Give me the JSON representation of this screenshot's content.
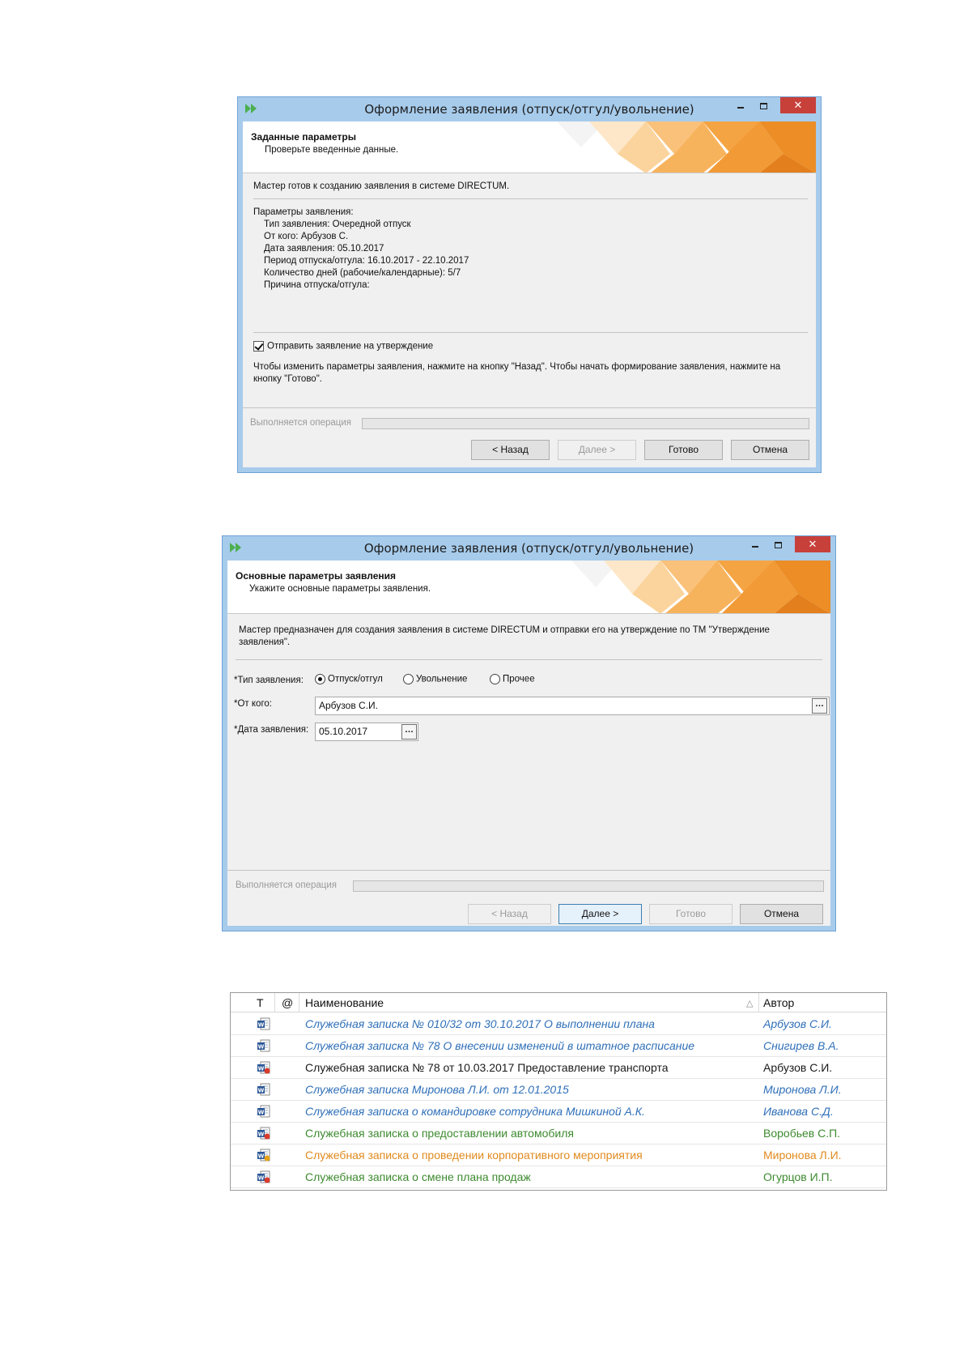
{
  "dialog1": {
    "title": "Оформление заявления (отпуск/отгул/увольнение)",
    "header_title": "Заданные параметры",
    "header_sub": "Проверьте введенные данные.",
    "intro": "Мастер готов к созданию заявления в системе DIRECTUM.",
    "params_title": "Параметры заявления:",
    "params": [
      "Тип заявления:  Очередной отпуск",
      "От кого:  Арбузов С.",
      "Дата заявления:  05.10.2017",
      "Период отпуска/отгула:  16.10.2017 - 22.10.2017",
      "Количество дней (рабочие/календарные):  5/7",
      "Причина отпуска/отгула:"
    ],
    "checkbox_label": "Отправить заявление на утверждение",
    "hint_line1": "Чтобы изменить параметры заявления, нажмите на кнопку \"Назад\". Чтобы начать формирование заявления, нажмите на",
    "hint_line2": "кнопку \"Готово\".",
    "op_label": "Выполняется операция",
    "buttons": {
      "back": "< Назад",
      "next": "Далее >",
      "finish": "Готово",
      "cancel": "Отмена"
    }
  },
  "dialog2": {
    "title": "Оформление заявления (отпуск/отгул/увольнение)",
    "header_title": "Основные параметры заявления",
    "header_sub": "Укажите основные параметры заявления.",
    "intro_line1": "Мастер предназначен для создания заявления в системе DIRECTUM и отправки его на утверждение по ТМ \"Утверждение",
    "intro_line2": "заявления\".",
    "type_label": "*Тип заявления:",
    "radios": [
      "Отпуск/отгул",
      "Увольнение",
      "Прочее"
    ],
    "from_label": "*От кого:",
    "from_value": "Арбузов С.И.",
    "date_label": "*Дата заявления:",
    "date_value": "05.10.2017",
    "op_label": "Выполняется операция",
    "buttons": {
      "back": "< Назад",
      "next": "Далее >",
      "finish": "Готово",
      "cancel": "Отмена"
    }
  },
  "list": {
    "headers": {
      "type": "Т",
      "at": "@",
      "name": "Наименование",
      "author": "Автор"
    },
    "rows": [
      {
        "name": "Служебная записка № 010/32 от 30.10.2017 О выполнении плана",
        "author": "Арбузов С.И.",
        "color": "#2e6fb8",
        "italic": true
      },
      {
        "name": "Служебная записка № 78 О внесении изменений в штатное расписание",
        "author": "Снигирев В.А.",
        "color": "#2e6fb8",
        "italic": true
      },
      {
        "name": "Служебная записка № 78 от 10.03.2017 Предоставление транспорта",
        "author": "Арбузов С.И.",
        "color": "#1a1a1a",
        "italic": false
      },
      {
        "name": "Служебная записка Миронова Л.И.  от 12.01.2015",
        "author": "Миронова Л.И.",
        "color": "#2e6fb8",
        "italic": true
      },
      {
        "name": "Служебная записка о командировке сотрудника Мишкиной А.К.",
        "author": "Иванова С.Д.",
        "color": "#2e6fb8",
        "italic": true
      },
      {
        "name": "Служебная записка о предоставлении автомобиля",
        "author": "Воробьев С.П.",
        "color": "#3d8a2f",
        "italic": false
      },
      {
        "name": "Служебная записка о проведении корпоративного мероприятия",
        "author": "Миронова Л.И.",
        "color": "#e08a1e",
        "italic": false
      },
      {
        "name": "Служебная записка о смене плана продаж",
        "author": "Огурцов И.П.",
        "color": "#3d8a2f",
        "italic": false
      }
    ]
  }
}
